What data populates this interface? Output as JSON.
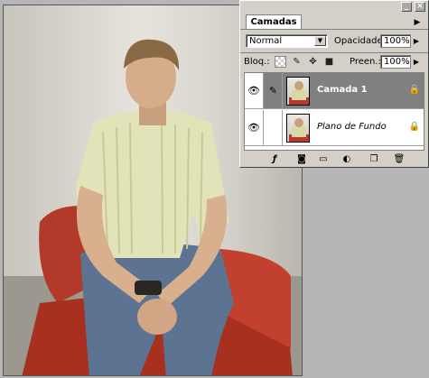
{
  "palette": {
    "tab_label": "Camadas",
    "blend_mode": "Normal",
    "opacity_label": "Opacidade:",
    "opacity_value": "100%",
    "lock_label": "Bloq.:",
    "fill_label": "Preen.:",
    "fill_value": "100%"
  },
  "layers": [
    {
      "name": "Camada 1"
    },
    {
      "name": "Plano de Fundo"
    }
  ],
  "colors": {
    "selected_layer": "#808080",
    "highlight_ellipse": "#e00000",
    "panel": "#d4d0c8"
  },
  "icons": [
    "eye-icon",
    "brush-icon",
    "move-icon",
    "lock-icon",
    "transparency-lock-icon",
    "fx-icon",
    "mask-icon",
    "folder-icon",
    "adjustment-icon",
    "new-layer-icon",
    "trash-icon",
    "palette-menu-icon",
    "minimize-icon",
    "close-icon"
  ]
}
